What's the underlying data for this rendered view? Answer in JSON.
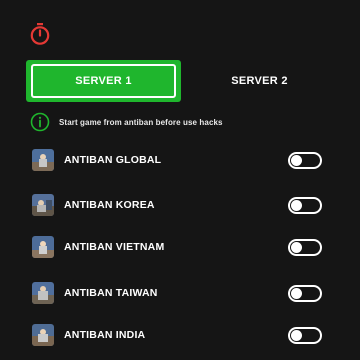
{
  "header": {
    "timer_icon": "stopwatch-icon",
    "timer_color": "#e53935"
  },
  "tabs": [
    {
      "label": "SERVER 1",
      "active": true
    },
    {
      "label": "SERVER 2",
      "active": false
    }
  ],
  "notice": {
    "icon": "info-icon",
    "text": "Start game from antiban before use hacks",
    "icon_color": "#1fb62d"
  },
  "accent_color": "#1fb62d",
  "servers": [
    {
      "name": "ANTIBAN GLOBAL",
      "enabled": false
    },
    {
      "name": "ANTIBAN KOREA",
      "enabled": false
    },
    {
      "name": "ANTIBAN VIETNAM",
      "enabled": false
    },
    {
      "name": "ANTIBAN TAIWAN",
      "enabled": false
    },
    {
      "name": "ANTIBAN INDIA",
      "enabled": false
    }
  ]
}
